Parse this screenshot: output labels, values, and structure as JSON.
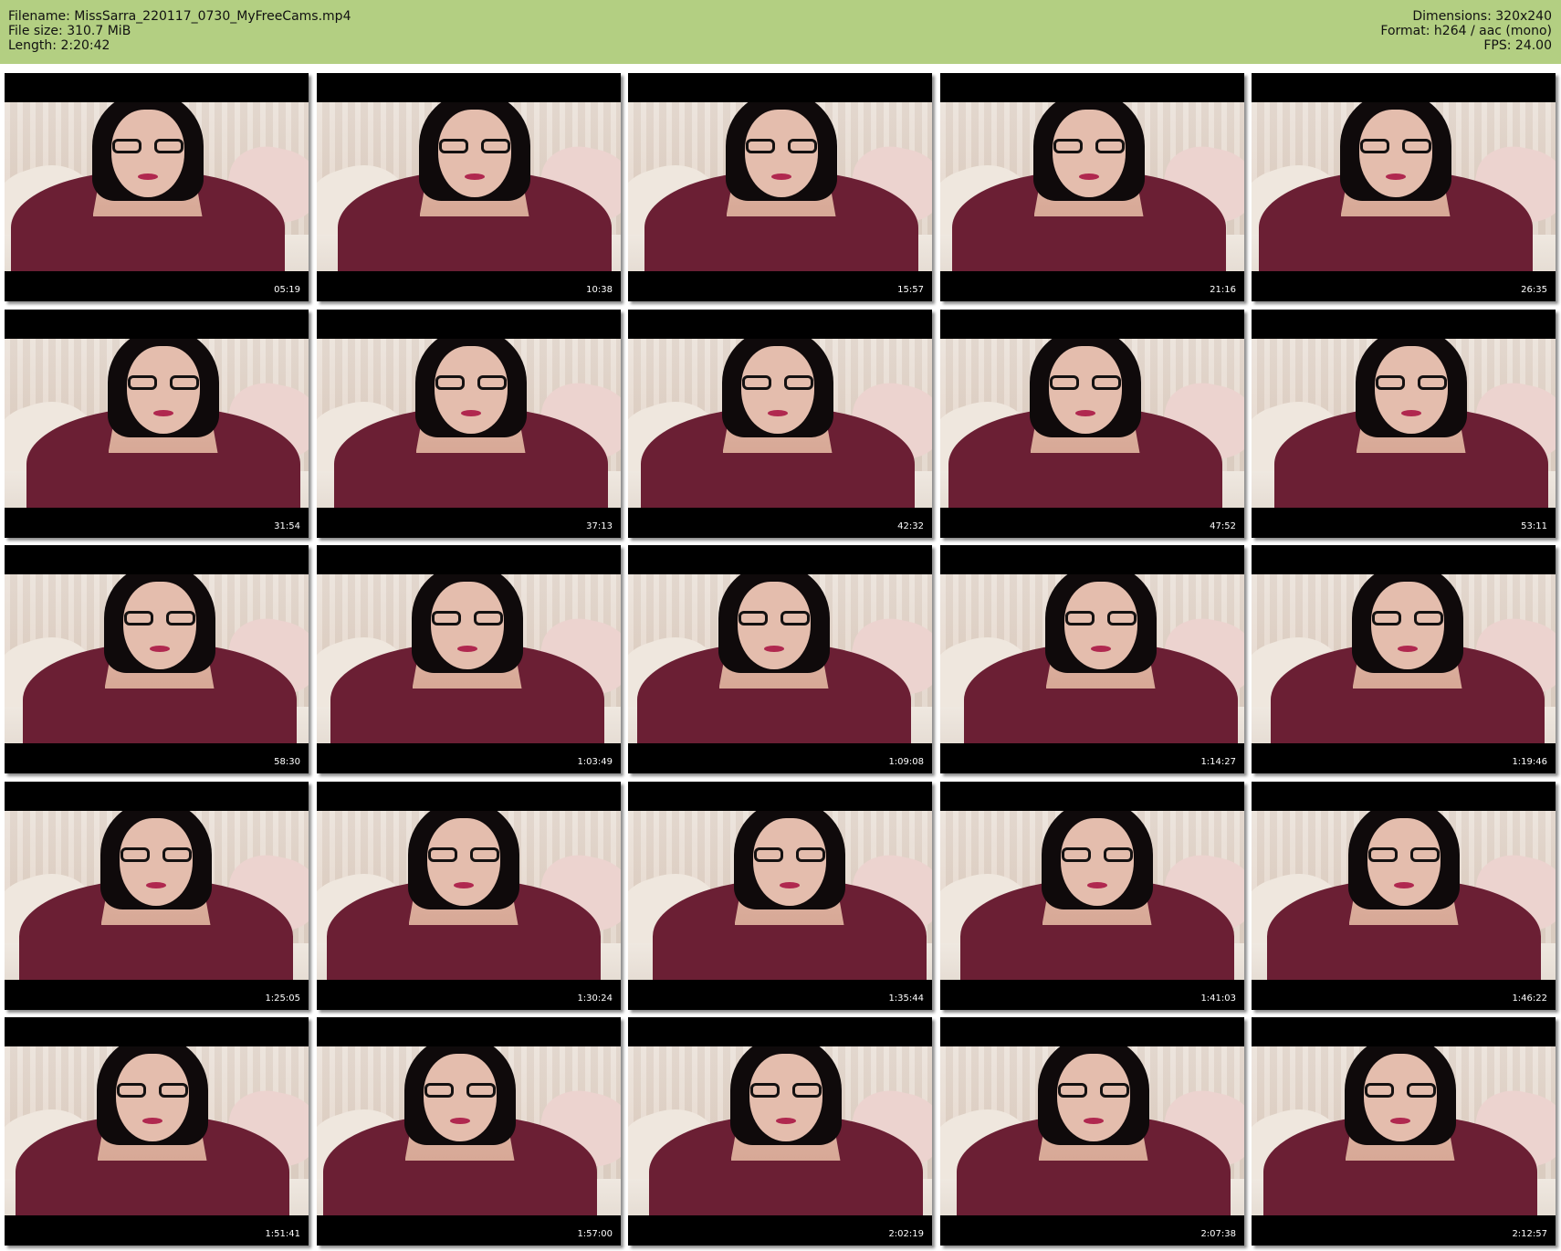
{
  "header": {
    "filename_line": "Filename: MissSarra_220117_0730_MyFreeCams.mp4",
    "filesize_line": "File size: 310.7 MiB",
    "length_line": "Length: 2:20:42",
    "dimensions_line": "Dimensions: 320x240",
    "format_line": "Format: h264 / aac (mono)",
    "fps_line": "FPS: 24.00"
  },
  "colors": {
    "header_background": "#b3cf82",
    "page_background": "#ffffff",
    "thumbnail_letterbox": "#000000",
    "timestamp_text": "#ffffff"
  },
  "thumbnails": [
    {
      "timestamp": "05:19"
    },
    {
      "timestamp": "10:38"
    },
    {
      "timestamp": "15:57"
    },
    {
      "timestamp": "21:16"
    },
    {
      "timestamp": "26:35"
    },
    {
      "timestamp": "31:54"
    },
    {
      "timestamp": "37:13"
    },
    {
      "timestamp": "42:32"
    },
    {
      "timestamp": "47:52"
    },
    {
      "timestamp": "53:11"
    },
    {
      "timestamp": "58:30"
    },
    {
      "timestamp": "1:03:49"
    },
    {
      "timestamp": "1:09:08"
    },
    {
      "timestamp": "1:14:27"
    },
    {
      "timestamp": "1:19:46"
    },
    {
      "timestamp": "1:25:05"
    },
    {
      "timestamp": "1:30:24"
    },
    {
      "timestamp": "1:35:44"
    },
    {
      "timestamp": "1:41:03"
    },
    {
      "timestamp": "1:46:22"
    },
    {
      "timestamp": "1:51:41"
    },
    {
      "timestamp": "1:57:00"
    },
    {
      "timestamp": "2:02:19"
    },
    {
      "timestamp": "2:07:38"
    },
    {
      "timestamp": "2:12:57"
    }
  ]
}
